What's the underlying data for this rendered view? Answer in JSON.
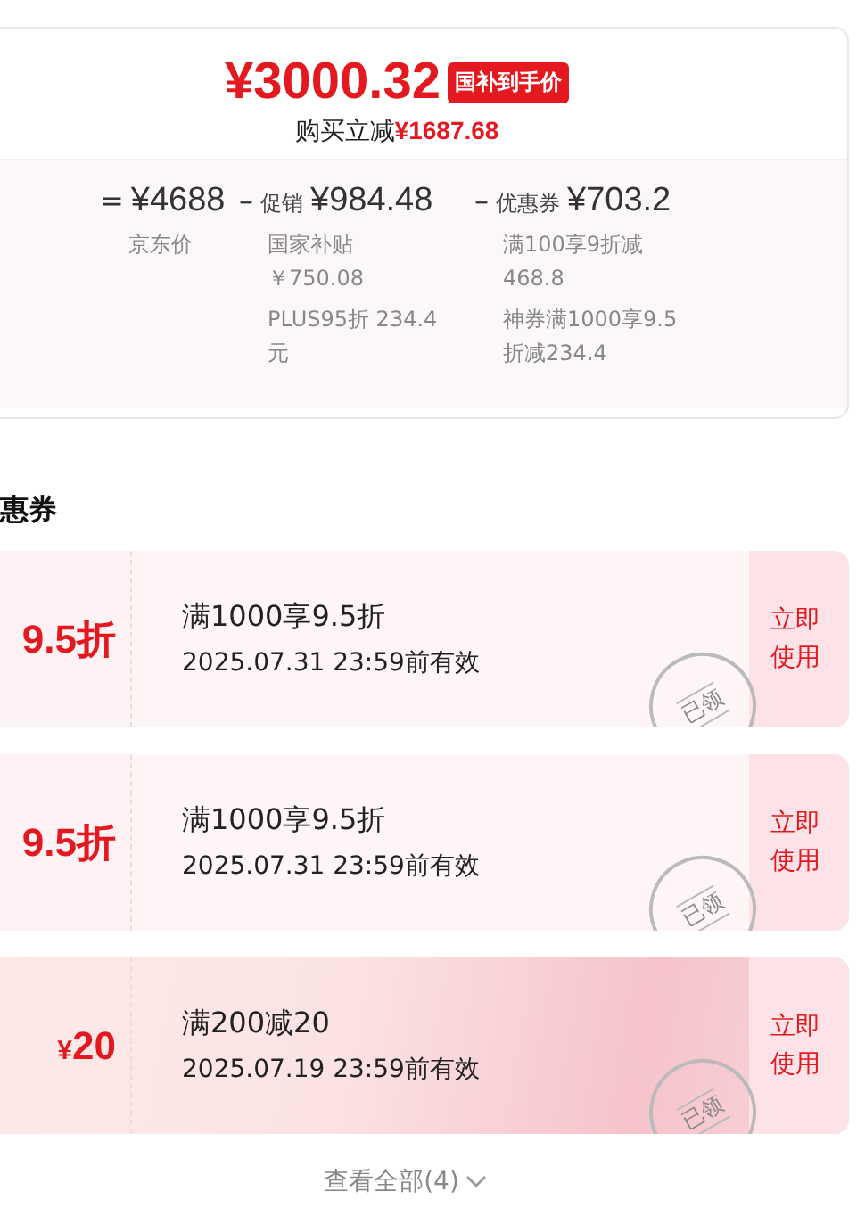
{
  "price_card": {
    "price": "¥3000.32",
    "badge": "国补到手价",
    "saving_label": "购买立减",
    "saving_amount": "¥1687.68",
    "breakdown": [
      {
        "operator": "=",
        "amount": "¥4688",
        "caption": "京东价"
      },
      {
        "operator": "–",
        "label": "促销",
        "amount": "¥984.48",
        "details": [
          "国家补贴￥750.08",
          "PLUS95折 234.4元"
        ]
      },
      {
        "operator": "–",
        "label": "优惠券",
        "amount": "¥703.2",
        "details": [
          "满100享9折减468.8",
          "神券满1000享9.5折减234.4"
        ]
      }
    ]
  },
  "coupons_section": {
    "title": "惠券",
    "coupons": [
      {
        "kind": "discount",
        "value": "9.5折",
        "condition": "满1000享9.5折",
        "validity": "2025.07.31  23:59前有效",
        "stamp": "已领",
        "action": "立即使用"
      },
      {
        "kind": "discount",
        "value": "9.5折",
        "condition": "满1000享9.5折",
        "validity": "2025.07.31  23:59前有效",
        "stamp": "已领",
        "action": "立即使用"
      },
      {
        "kind": "featured",
        "value": "¥20",
        "condition": "满200减20",
        "validity": "2025.07.19 23:59前有效",
        "stamp": "已领",
        "action": "立即使用"
      }
    ],
    "view_all": "查看全部(4)"
  }
}
